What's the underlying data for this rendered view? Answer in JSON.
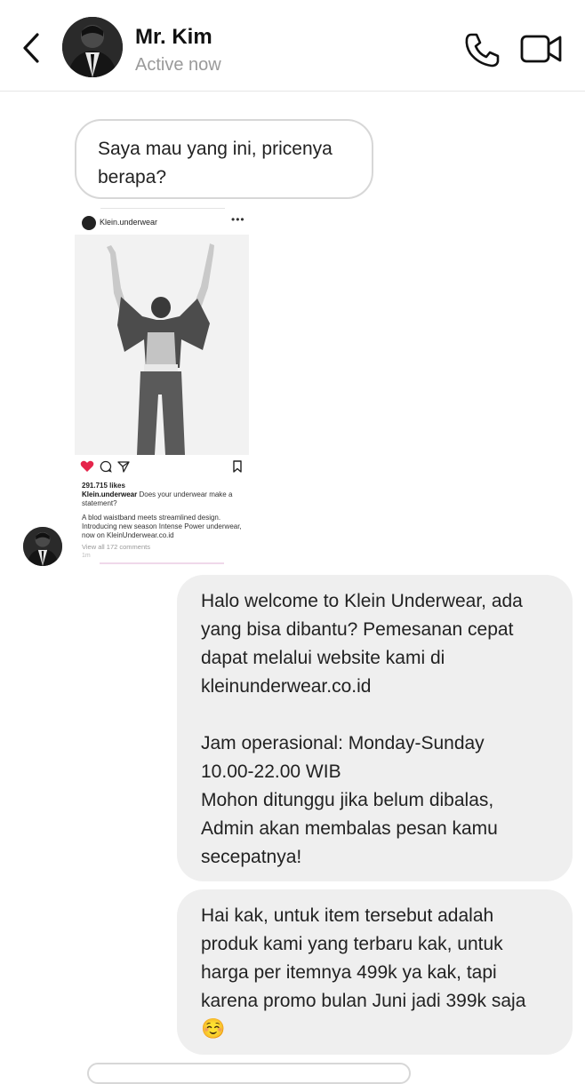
{
  "header": {
    "contact_name": "Mr. Kim",
    "status": "Active now"
  },
  "messages": {
    "incoming_text": {
      "lines": [
        "Saya mau yang ini, pricenya",
        "berapa?"
      ]
    },
    "shared_post": {
      "username": "Klein.underwear",
      "likes": "291.715 likes",
      "caption_user": "Klein.underwear",
      "caption_text": "Does your underwear make a statement?",
      "description_lines": [
        "A blod waistband meets streamlined design.",
        "Introducing new season Intense Power underwear,",
        "now on KleinUnderwear.co.id"
      ],
      "comments_link": "View all 172 comments",
      "time": "1m"
    },
    "outgoing_auto_reply": {
      "lines_block1": [
        "Halo welcome to Klein Underwear, ada",
        "yang bisa dibantu? Pemesanan cepat",
        "dapat melalui website kami di",
        "kleinunderwear.co.id"
      ],
      "lines_block2": [
        "Jam operasional: Monday-Sunday",
        "10.00-22.00 WIB",
        "Mohon ditunggu jika belum dibalas,",
        "Admin akan membalas pesan kamu",
        "secepatnya!"
      ]
    },
    "outgoing_price_reply": {
      "lines": [
        "Hai kak, untuk item tersebut adalah",
        "produk kami yang terbaru kak, untuk",
        "harga per itemnya 499k ya kak, tapi",
        "karena promo bulan Juni jadi 399k saja"
      ],
      "emoji": "☺️"
    }
  },
  "icons": {
    "back": "chevron-left-icon",
    "call": "phone-icon",
    "video": "video-camera-icon",
    "like": "heart-icon",
    "comment": "comment-icon",
    "share": "send-icon",
    "save": "bookmark-icon"
  },
  "colors": {
    "outgoing_bubble": "#efefef",
    "incoming_border": "#d7d7d7",
    "status_gray": "#9a9a9a",
    "like_red": "#e5254b"
  }
}
